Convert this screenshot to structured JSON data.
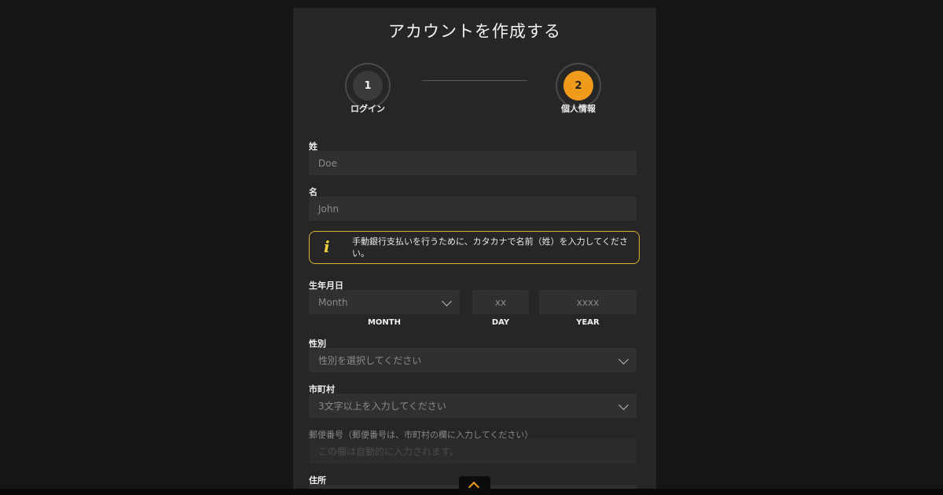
{
  "title": "アカウントを作成する",
  "steps": [
    {
      "number": "1",
      "label": "ログイン"
    },
    {
      "number": "2",
      "label": "個人情報"
    }
  ],
  "form": {
    "last_name": {
      "label": "姓",
      "placeholder": "Doe"
    },
    "first_name": {
      "label": "名",
      "placeholder": "John"
    },
    "notice": {
      "icon": "info-icon",
      "text": "手動銀行支払いを行うために、カタカナで名前（姓）を入力してください。"
    },
    "dob": {
      "label": "生年月日",
      "month_placeholder": "Month",
      "day_placeholder": "xx",
      "year_placeholder": "xxxx",
      "month_label": "MONTH",
      "day_label": "DAY",
      "year_label": "YEAR"
    },
    "gender": {
      "label": "性別",
      "placeholder": "性別を選択してください"
    },
    "city": {
      "label": "市町村",
      "placeholder": "3文字以上を入力してください"
    },
    "postal": {
      "label": "郵便番号（郵便番号は、市町村の欄に入力してください）",
      "placeholder": "この欄は自動的に入力されます。"
    },
    "address": {
      "label": "住所"
    }
  },
  "colors": {
    "accent": "#f09a1c",
    "notice_border": "#d7b534",
    "panel": "#262626",
    "background": "#151515"
  }
}
